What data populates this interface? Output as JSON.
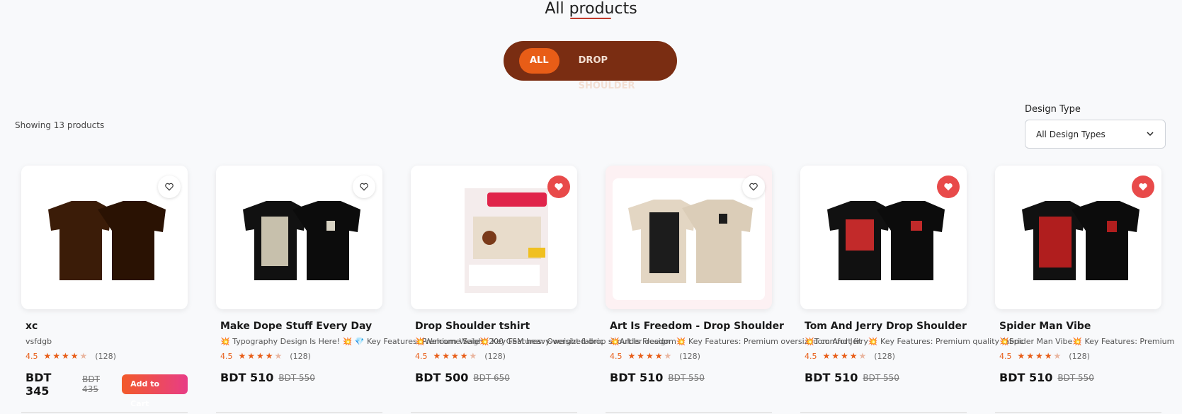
{
  "header": {
    "title": "All products"
  },
  "tabs": [
    {
      "label": "ALL",
      "active": true
    },
    {
      "label": "DROP SHOULDER",
      "active": false
    }
  ],
  "filters": {
    "showing_text": "Showing 13 products",
    "design_type_label": "Design Type",
    "design_type_value": "All Design Types"
  },
  "colors": {
    "accent": "#e85d17",
    "tabs_bg": "#7a2d12",
    "wishlist_active": "#e84a4a"
  },
  "products": [
    {
      "name": "xc",
      "description": "vsfdgb",
      "rating": "4.5",
      "stars": 4,
      "reviews": "(128)",
      "price": "BDT 345",
      "old_price": "BDT 435",
      "add_to_cart_label": "Add to Cart",
      "wishlisted": false
    },
    {
      "name": "Make Dope Stuff Every Day",
      "description": "💥 Typography Design Is Here! 💥  💎 Key Features: Premium Weight 200 GSM heavy-weight fabric",
      "rating": "4.5",
      "stars": 4,
      "reviews": "(128)",
      "price": "BDT 510",
      "old_price": "BDT 550",
      "wishlisted": false
    },
    {
      "name": "Drop Shoulder tshirt",
      "description": "💥Welcome Sale💥 Key Features: Oversized drop shoulder design",
      "rating": "4.5",
      "stars": 4,
      "reviews": "(128)",
      "price": "BDT 500",
      "old_price": "BDT 650",
      "wishlisted": true
    },
    {
      "name": "Art Is Freedom - Drop Shoulder",
      "description": "💥Art Is Freedom💥 Key Features: Premium oversized comfort fit",
      "rating": "4.5",
      "stars": 4,
      "reviews": "(128)",
      "price": "BDT 510",
      "old_price": "BDT 550",
      "wishlisted": false
    },
    {
      "name": "Tom And Jerry Drop Shoulder",
      "description": "💥Tom And Jerry💥 Key Features: Premium quality fabric",
      "rating": "4.5",
      "stars": 4,
      "reviews": "(128)",
      "price": "BDT 510",
      "old_price": "BDT 550",
      "wishlisted": true
    },
    {
      "name": "Spider Man Vibe",
      "description": "💥Spider Man Vibe💥 Key Features: Premium oversized fit",
      "rating": "4.5",
      "stars": 4,
      "reviews": "(128)",
      "price": "BDT 510",
      "old_price": "BDT 550",
      "wishlisted": true
    }
  ]
}
